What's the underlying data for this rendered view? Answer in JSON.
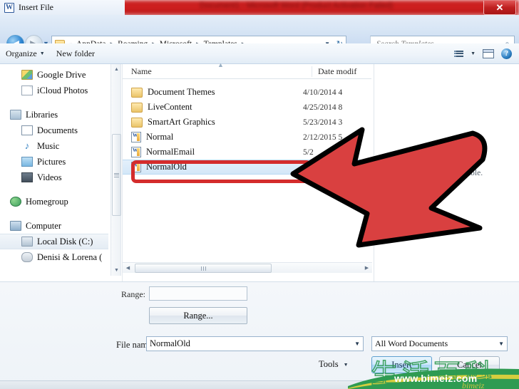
{
  "background_window": {
    "blurred_title": "Document1 - Microsoft Word (Product Activation Failed)"
  },
  "dialog": {
    "title": "Insert File",
    "app_icon": "word-icon",
    "close_label": "✕"
  },
  "address_bar": {
    "back_icon": "back-arrow-icon",
    "forward_icon": "forward-arrow-icon",
    "history_icon": "chevron-down-icon",
    "folder_icon": "folder-icon",
    "overflow": "«",
    "crumbs": [
      "AppData",
      "Roaming",
      "Microsoft",
      "Templates"
    ],
    "separator": "▸",
    "dropdown_icon": "chevron-down-icon",
    "refresh_icon": "refresh-icon",
    "refresh_glyph": "↻"
  },
  "search": {
    "placeholder": "Search Templates",
    "icon": "search-icon",
    "glyph": "⌕"
  },
  "toolbar": {
    "organize_label": "Organize",
    "organize_caret": "▼",
    "new_folder_label": "New folder",
    "view_icon": "view-options-icon",
    "view_caret": "▼",
    "pane_icon": "preview-pane-icon",
    "help_icon": "help-icon",
    "help_glyph": "?"
  },
  "sidebar": {
    "items": [
      {
        "label": "Google Drive",
        "icon": "google-drive-icon",
        "indent": "child",
        "selected": false
      },
      {
        "label": "iCloud Photos",
        "icon": "document-icon",
        "indent": "child",
        "selected": false
      },
      {
        "label": "Libraries",
        "icon": "libraries-icon",
        "indent": "root",
        "selected": false
      },
      {
        "label": "Documents",
        "icon": "documents-icon",
        "indent": "child",
        "selected": false
      },
      {
        "label": "Music",
        "icon": "music-icon",
        "indent": "child",
        "selected": false
      },
      {
        "label": "Pictures",
        "icon": "pictures-icon",
        "indent": "child",
        "selected": false
      },
      {
        "label": "Videos",
        "icon": "videos-icon",
        "indent": "child",
        "selected": false
      },
      {
        "label": "Homegroup",
        "icon": "homegroup-icon",
        "indent": "root",
        "selected": false
      },
      {
        "label": "Computer",
        "icon": "computer-icon",
        "indent": "root",
        "selected": false
      },
      {
        "label": "Local Disk (C:)",
        "icon": "disk-icon",
        "indent": "child",
        "selected": true
      },
      {
        "label": "Denisi & Lorena (",
        "icon": "usb-drive-icon",
        "indent": "child",
        "selected": false
      }
    ],
    "scroll_up_icon": "scroll-up-arrow",
    "scroll_down_icon": "scroll-down-arrow"
  },
  "file_list": {
    "columns": {
      "name": "Name",
      "date": "Date modif"
    },
    "sort_caret": "▲",
    "rows": [
      {
        "name": "Document Themes",
        "date": "4/10/2014 4",
        "icon": "folder-icon",
        "selected": false
      },
      {
        "name": "LiveContent",
        "date": "4/25/2014 8",
        "icon": "folder-icon",
        "selected": false
      },
      {
        "name": "SmartArt Graphics",
        "date": "5/23/2014 3",
        "icon": "folder-icon",
        "selected": false
      },
      {
        "name": "Normal",
        "date": "2/12/2015 5",
        "icon": "word-template-icon",
        "selected": false
      },
      {
        "name": "NormalEmail",
        "date": "5/2",
        "icon": "word-template-icon",
        "selected": false
      },
      {
        "name": "NormalOld",
        "date": "",
        "icon": "word-template-icon",
        "selected": true
      }
    ],
    "hscroll_left_icon": "scroll-left-arrow",
    "hscroll_right_icon": "scroll-right-arrow"
  },
  "preview": {
    "message": "No preview available."
  },
  "bottom": {
    "range_label": "Range:",
    "range_value": "",
    "range_button": "Range...",
    "file_name_label": "File name:",
    "file_name_value": "NormalOld",
    "file_type_value": "All Word Documents",
    "tools_label": "Tools",
    "tools_caret": "▼",
    "insert_label": "Insert",
    "cancel_label": "Cancel",
    "dropdown_caret": "▼"
  },
  "annotations": {
    "highlight_color": "#d42c2c",
    "arrow_color": "#d94040",
    "arrow_name": "red-pointer-arrow",
    "highlight_target": "NormalOld"
  },
  "watermark": {
    "characters": "生活百科",
    "url": "www.bimeiz.com",
    "site_mark": "bimeiz",
    "color": "#2f9b52"
  }
}
